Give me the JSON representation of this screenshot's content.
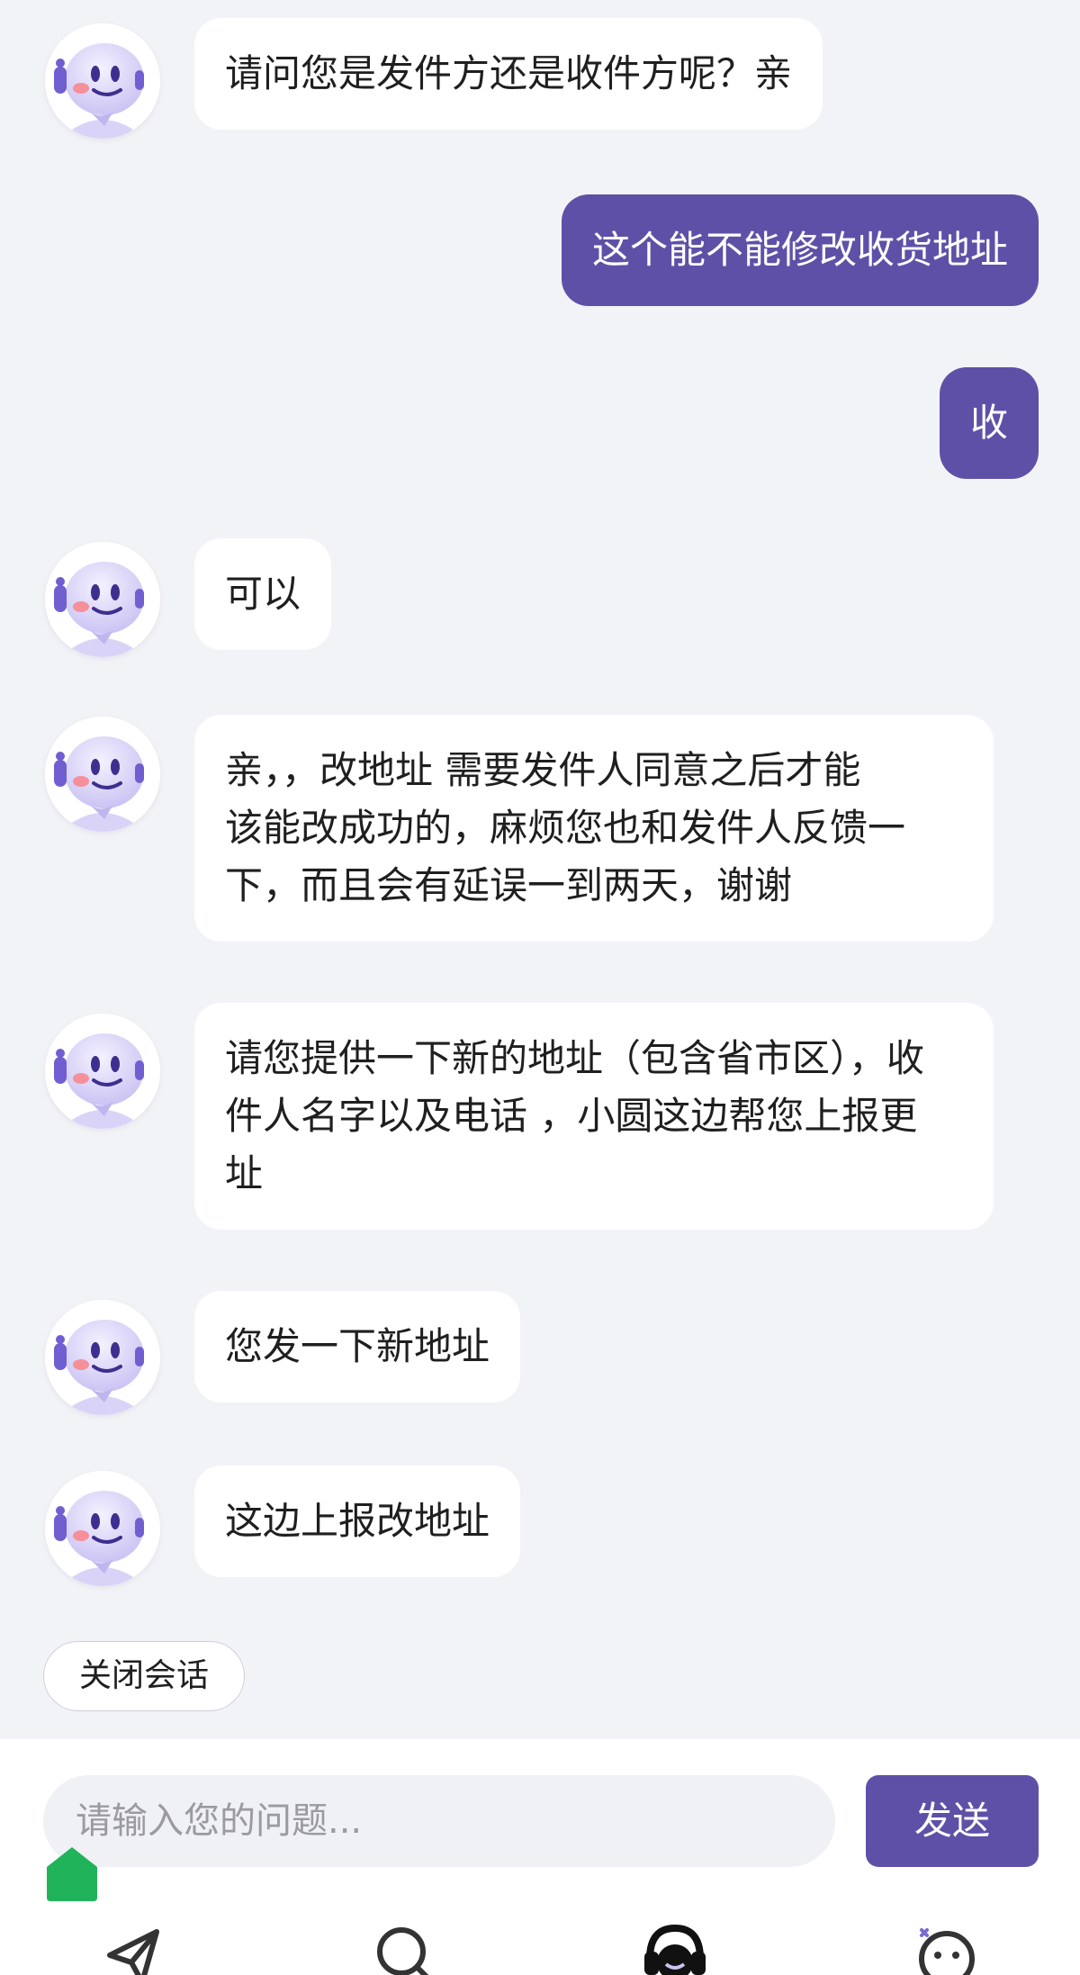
{
  "messages": [
    {
      "side": "bot",
      "text": "请问您是发件方还是收件方呢？亲"
    },
    {
      "side": "user",
      "text": "这个能不能修改收货地址"
    },
    {
      "side": "user",
      "text": "收"
    },
    {
      "side": "bot",
      "text": "可以"
    },
    {
      "side": "bot",
      "lines": [
        "亲，，改地址 需要发件人同意之后才能",
        "该能改成功的，麻烦您也和发件人反馈一",
        "下，而且会有延误一到两天，谢谢"
      ]
    },
    {
      "side": "bot",
      "lines": [
        "请您提供一下新的地址（包含省市区），收",
        "件人名字以及电话 ，小圆这边帮您上报更",
        "址"
      ]
    },
    {
      "side": "bot",
      "text": "您发一下新地址"
    },
    {
      "side": "bot",
      "text": "这边上报改地址"
    }
  ],
  "close_label": "关闭会话",
  "input": {
    "placeholder": "请输入您的问题..."
  },
  "send_label": "发送",
  "tabs": [
    {
      "icon": "send-icon"
    },
    {
      "icon": "search-icon"
    },
    {
      "icon": "customer-service-icon"
    },
    {
      "icon": "smile-icon"
    }
  ],
  "colors": {
    "accent": "#5f50a7",
    "background": "#f2f3f6",
    "badge": "#21b35a"
  }
}
